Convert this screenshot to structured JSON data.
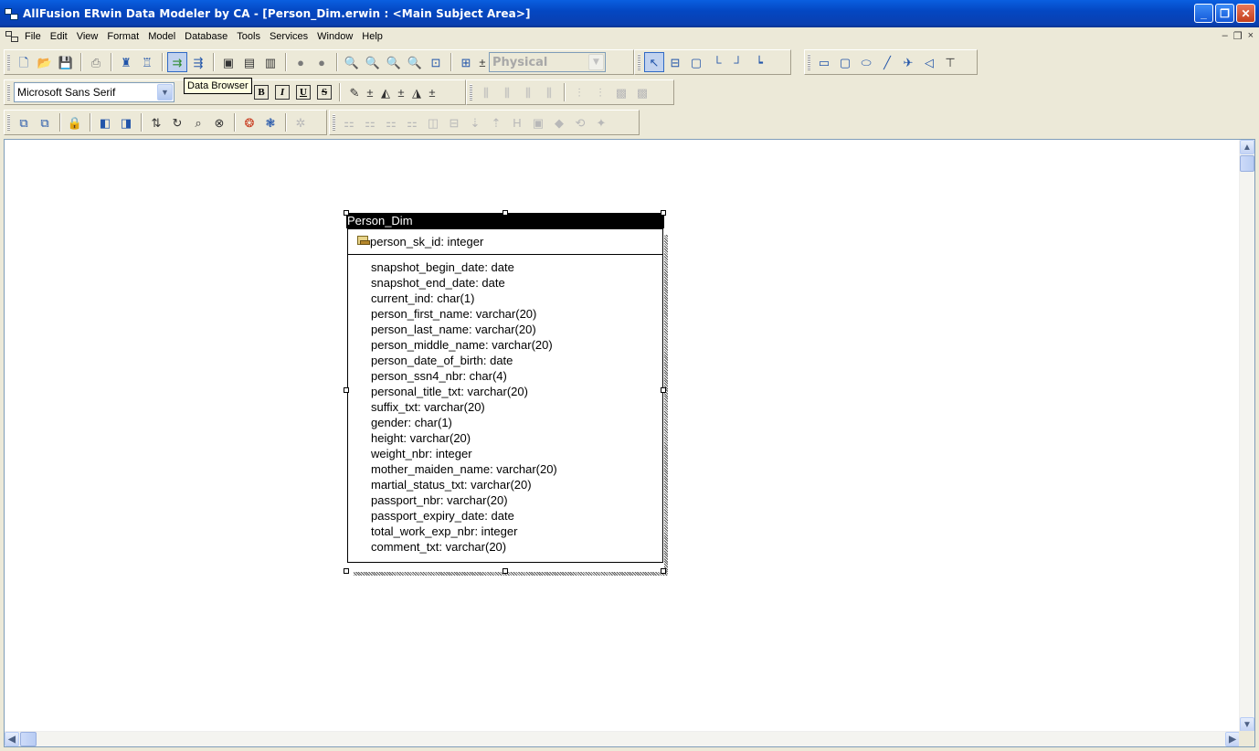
{
  "window": {
    "title": "AllFusion ERwin Data Modeler by CA - [Person_Dim.erwin : <Main Subject Area>]",
    "controls": {
      "minimize": "_",
      "restore": "❐",
      "close": "✕"
    }
  },
  "menubar": {
    "items": [
      "File",
      "Edit",
      "View",
      "Format",
      "Model",
      "Database",
      "Tools",
      "Services",
      "Window",
      "Help"
    ],
    "mdi_controls": {
      "minimize": "–",
      "restore": "❐",
      "close": "×"
    }
  },
  "toolbar": {
    "view_combo": {
      "value": "Physical"
    },
    "font_combo": {
      "value": "Microsoft Sans Serif"
    },
    "tooltip": "Data Browser",
    "format_letters": {
      "bold": "B",
      "italic": "I",
      "underline": "U",
      "strike": "S"
    }
  },
  "canvas": {
    "entity": {
      "name": "Person_Dim",
      "primary_key": "person_sk_id: integer",
      "attributes": [
        "snapshot_begin_date: date",
        "snapshot_end_date: date",
        "current_ind: char(1)",
        "person_first_name: varchar(20)",
        "person_last_name: varchar(20)",
        "person_middle_name: varchar(20)",
        "person_date_of_birth: date",
        "person_ssn4_nbr: char(4)",
        "personal_title_txt: varchar(20)",
        "suffix_txt: varchar(20)",
        "gender: char(1)",
        "height: varchar(20)",
        "weight_nbr: integer",
        "mother_maiden_name: varchar(20)",
        "martial_status_txt: varchar(20)",
        "passport_nbr: varchar(20)",
        "passport_expiry_date: date",
        "total_work_exp_nbr: integer",
        "comment_txt: varchar(20)"
      ]
    }
  },
  "icons": {
    "scroll_up": "▲",
    "scroll_down": "▼",
    "scroll_left": "◀",
    "scroll_right": "▶"
  }
}
